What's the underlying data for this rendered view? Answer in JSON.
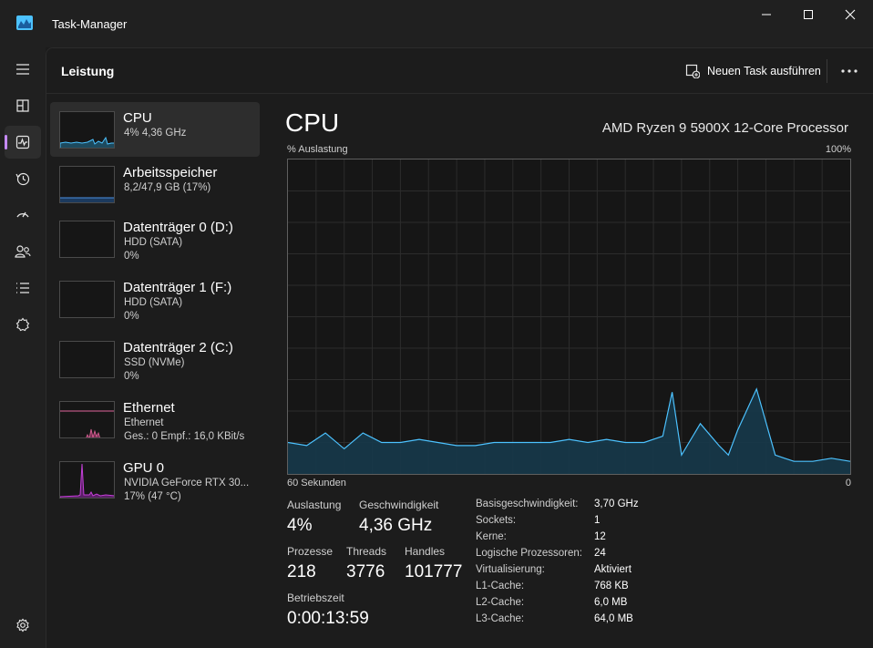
{
  "window": {
    "title": "Task-Manager"
  },
  "header": {
    "title": "Leistung",
    "new_task_label": "Neuen Task ausführen",
    "more_icon": "more-icon"
  },
  "nav": {
    "items": [
      {
        "icon": "hamburger-icon"
      },
      {
        "icon": "processes-icon"
      },
      {
        "icon": "performance-icon",
        "active": true
      },
      {
        "icon": "history-icon"
      },
      {
        "icon": "startup-icon"
      },
      {
        "icon": "users-icon"
      },
      {
        "icon": "details-icon"
      },
      {
        "icon": "services-icon"
      },
      {
        "icon": "settings-icon"
      }
    ]
  },
  "sidebar": {
    "items": [
      {
        "name": "CPU",
        "line1": "4% 4,36 GHz",
        "line2": ""
      },
      {
        "name": "Arbeitsspeicher",
        "line1": "8,2/47,9 GB (17%)",
        "line2": ""
      },
      {
        "name": "Datenträger 0 (D:)",
        "line1": "HDD (SATA)",
        "line2": "0%"
      },
      {
        "name": "Datenträger 1 (F:)",
        "line1": "HDD (SATA)",
        "line2": "0%"
      },
      {
        "name": "Datenträger 2 (C:)",
        "line1": "SSD (NVMe)",
        "line2": "0%"
      },
      {
        "name": "Ethernet",
        "line1": "Ethernet",
        "line2": "Ges.: 0 Empf.: 16,0 KBit/s"
      },
      {
        "name": "GPU 0",
        "line1": "NVIDIA GeForce RTX 30...",
        "line2": "17% (47 °C)"
      }
    ]
  },
  "cpu": {
    "title": "CPU",
    "model": "AMD Ryzen 9 5900X 12-Core Processor",
    "graph_label": "% Auslastung",
    "graph_max": "100%",
    "time_label": "60 Sekunden",
    "time_end": "0",
    "stats": {
      "utilization_label": "Auslastung",
      "utilization": "4%",
      "speed_label": "Geschwindigkeit",
      "speed": "4,36 GHz",
      "processes_label": "Prozesse",
      "processes": "218",
      "threads_label": "Threads",
      "threads": "3776",
      "handles_label": "Handles",
      "handles": "101777",
      "uptime_label": "Betriebszeit",
      "uptime": "0:00:13:59"
    },
    "info": [
      {
        "label": "Basisgeschwindigkeit:",
        "value": "3,70 GHz"
      },
      {
        "label": "Sockets:",
        "value": "1"
      },
      {
        "label": "Kerne:",
        "value": "12"
      },
      {
        "label": "Logische Prozessoren:",
        "value": "24"
      },
      {
        "label": "Virtualisierung:",
        "value": "Aktiviert"
      },
      {
        "label": "L1-Cache:",
        "value": "768 KB"
      },
      {
        "label": "L2-Cache:",
        "value": "6,0 MB"
      },
      {
        "label": "L3-Cache:",
        "value": "64,0 MB"
      }
    ]
  },
  "colors": {
    "cpu": "#4cc2ff",
    "memory": "#4a90e2",
    "ethernet": "#e0649a",
    "gpu": "#c43fd8",
    "accent": "#c58af9"
  },
  "chart_data": {
    "type": "area",
    "x": [
      60,
      58,
      56,
      54,
      52,
      50,
      48,
      46,
      44,
      42,
      40,
      38,
      36,
      34,
      32,
      30,
      28,
      26,
      24,
      22,
      20,
      19,
      18,
      16,
      14,
      13,
      12,
      10,
      8,
      7,
      6,
      4,
      2,
      0
    ],
    "values": [
      10,
      9,
      13,
      8,
      13,
      10,
      10,
      11,
      10,
      9,
      9,
      10,
      10,
      10,
      10,
      11,
      10,
      11,
      10,
      10,
      12,
      26,
      6,
      16,
      9,
      6,
      14,
      27,
      6,
      5,
      4,
      4,
      5,
      4
    ],
    "ylim": [
      0,
      100
    ],
    "xlim": [
      60,
      0
    ]
  }
}
